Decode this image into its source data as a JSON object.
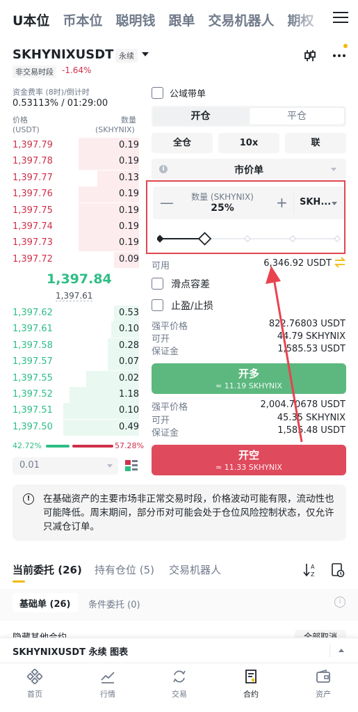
{
  "top_nav": {
    "tabs": [
      "U本位",
      "币本位",
      "聪明钱",
      "跟单",
      "交易机器人",
      "期权"
    ]
  },
  "header": {
    "symbol": "SKHYNIXUSDT",
    "contract_type": "永续",
    "session_status": "非交易时段",
    "change": "-1.64%"
  },
  "funding": {
    "label": "资金费率 (8时)/倒计时",
    "value": "0.53113% / 01:29:00"
  },
  "orderbook": {
    "price_header": "价格",
    "price_unit": "(USDT)",
    "qty_header": "数量",
    "qty_unit": "(SKHYNIX)",
    "asks": [
      {
        "price": "1,397.79",
        "qty": "0.19",
        "depth": 0.48
      },
      {
        "price": "1,397.78",
        "qty": "0.19",
        "depth": 0.48
      },
      {
        "price": "1,397.77",
        "qty": "0.13",
        "depth": 0.33
      },
      {
        "price": "1,397.76",
        "qty": "0.19",
        "depth": 0.48
      },
      {
        "price": "1,397.75",
        "qty": "0.19",
        "depth": 0.48
      },
      {
        "price": "1,397.74",
        "qty": "0.19",
        "depth": 0.48
      },
      {
        "price": "1,397.73",
        "qty": "0.19",
        "depth": 0.48
      },
      {
        "price": "1,397.72",
        "qty": "0.09",
        "depth": 0.2
      }
    ],
    "last_price": "1,397.84",
    "mark_price": "1,397.61",
    "bids": [
      {
        "price": "1,397.62",
        "qty": "0.53",
        "depth": 0.2
      },
      {
        "price": "1,397.61",
        "qty": "0.10",
        "depth": 0.22
      },
      {
        "price": "1,397.58",
        "qty": "0.28",
        "depth": 0.25
      },
      {
        "price": "1,397.57",
        "qty": "0.07",
        "depth": 0.25
      },
      {
        "price": "1,397.55",
        "qty": "0.02",
        "depth": 0.42
      },
      {
        "price": "1,397.52",
        "qty": "1.18",
        "depth": 0.55
      },
      {
        "price": "1,397.51",
        "qty": "0.10",
        "depth": 0.6
      },
      {
        "price": "1,397.50",
        "qty": "0.49",
        "depth": 0.6
      }
    ],
    "buy_ratio": "42.72%",
    "sell_ratio": "57.28%",
    "precision": "0.01"
  },
  "order_form": {
    "public_domain_label": "公域带单",
    "open_label": "开仓",
    "close_label": "平仓",
    "margin_mode": "全仓",
    "leverage": "10x",
    "position_mode": "联",
    "order_type": "市价单",
    "qty_label": "数量 (SKHYNIX)",
    "qty_value": "25%",
    "qty_unit": "SKH...",
    "slider_fraction": 0.25,
    "available_label": "可用",
    "available_value": "6,346.92 USDT",
    "slippage_label": "滑点容差",
    "tpsl_label": "止盈/止损",
    "long": {
      "liq_label": "强平价格",
      "liq_value": "822.76803 USDT",
      "open_label": "可开",
      "open_value": "44.79 SKHYNIX",
      "margin_label": "保证金",
      "margin_value": "1,585.53 USDT",
      "button_label": "开多",
      "button_sub": "≈ 11.19 SKHYNIX"
    },
    "short": {
      "liq_label": "强平价格",
      "liq_value": "2,004.70678 USDT",
      "open_label": "可开",
      "open_value": "45.35 SKHYNIX",
      "margin_label": "保证金",
      "margin_value": "1,585.48 USDT",
      "button_label": "开空",
      "button_sub": "≈ 11.33 SKHYNIX"
    }
  },
  "notice": {
    "text": "在基础资产的主要市场非正常交易时段，价格波动可能有限，流动性也可能降低。周末期间，部分币对可能会处于仓位风险控制状态，仅允许只减仓订单。"
  },
  "bottom_tabs": {
    "open_orders": "当前委托 (26)",
    "positions": "持有仓位 (5)",
    "bots": "交易机器人",
    "basic_orders": "基础单 (26)",
    "conditional_orders": "条件委托 (0)",
    "hide_other": "隐藏其他合约",
    "cancel_all": "全部取消"
  },
  "chart_bar": {
    "title": "SKHYNIXUSDT 永续 图表"
  },
  "bottom_nav": {
    "items": [
      "首页",
      "行情",
      "交易",
      "合约",
      "资产"
    ]
  },
  "colors": {
    "accent": "#f0b90b",
    "buy": "#2ebd85",
    "sell": "#cf304a",
    "highlight": "#e0464f"
  }
}
